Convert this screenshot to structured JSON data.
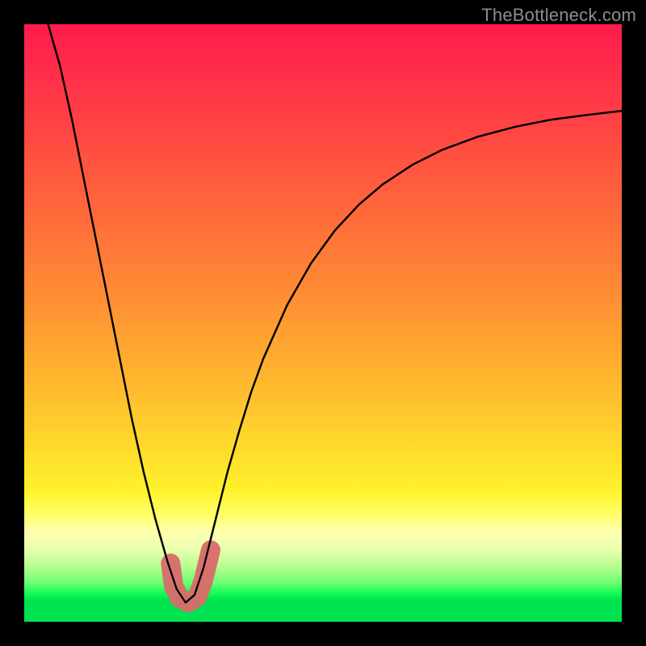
{
  "watermark": {
    "text": "TheBottleneck.com"
  },
  "chart_data": {
    "type": "line",
    "title": "",
    "xlabel": "",
    "ylabel": "",
    "xlim": [
      0,
      1
    ],
    "ylim": [
      0,
      1
    ],
    "series": [
      {
        "name": "bottleneck-curve",
        "note": "V-shaped curve; x and y normalized to 0..1 (y=0 at bottom, y=1 at top). Minimum near x≈0.27 where y≈0.03.",
        "x": [
          0.04,
          0.06,
          0.08,
          0.1,
          0.12,
          0.14,
          0.16,
          0.18,
          0.2,
          0.22,
          0.24,
          0.255,
          0.27,
          0.285,
          0.3,
          0.32,
          0.34,
          0.36,
          0.38,
          0.4,
          0.44,
          0.48,
          0.52,
          0.56,
          0.6,
          0.65,
          0.7,
          0.76,
          0.82,
          0.88,
          0.94,
          1.0
        ],
        "y": [
          1.0,
          0.93,
          0.84,
          0.74,
          0.64,
          0.54,
          0.44,
          0.34,
          0.25,
          0.17,
          0.1,
          0.055,
          0.032,
          0.045,
          0.09,
          0.17,
          0.25,
          0.32,
          0.385,
          0.44,
          0.53,
          0.6,
          0.655,
          0.698,
          0.732,
          0.765,
          0.79,
          0.812,
          0.828,
          0.84,
          0.848,
          0.855
        ]
      },
      {
        "name": "highlight-band",
        "note": "Pink L-shaped marker hugging the curve trough",
        "x": [
          0.245,
          0.25,
          0.26,
          0.275,
          0.29,
          0.3,
          0.312
        ],
        "y": [
          0.098,
          0.06,
          0.04,
          0.032,
          0.042,
          0.07,
          0.12
        ]
      }
    ]
  },
  "colors": {
    "curve": "#000000",
    "highlight": "#d96a6a",
    "bg_top": "#ff1a4b",
    "bg_bottom": "#00e24f",
    "frame": "#000000"
  }
}
